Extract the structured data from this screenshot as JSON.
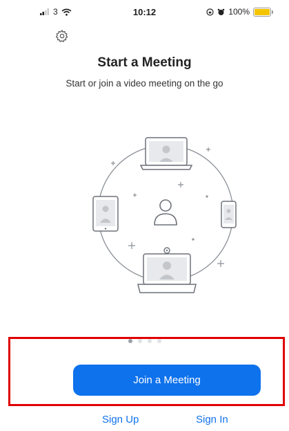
{
  "status_bar": {
    "carrier": "3",
    "time": "10:12",
    "battery": "100%",
    "icons": [
      "signal-icon",
      "wifi-icon",
      "orientation-lock-icon",
      "alarm-icon",
      "battery-icon"
    ],
    "battery_color": "#f5c400"
  },
  "header": {
    "settings_icon": "gear-icon",
    "title": "Start a Meeting",
    "subtitle": "Start or join a video meeting on the go"
  },
  "illustration": {
    "icons": [
      "laptop-icon",
      "tablet-icon",
      "phone-icon",
      "desktop-icon",
      "person-icon"
    ]
  },
  "pager": {
    "total": 4,
    "active_index": 0
  },
  "actions": {
    "join_label": "Join a Meeting",
    "signup_label": "Sign Up",
    "signin_label": "Sign In"
  },
  "colors": {
    "accent": "#0e72ed",
    "highlight": "#e00000",
    "text": "#222222"
  }
}
